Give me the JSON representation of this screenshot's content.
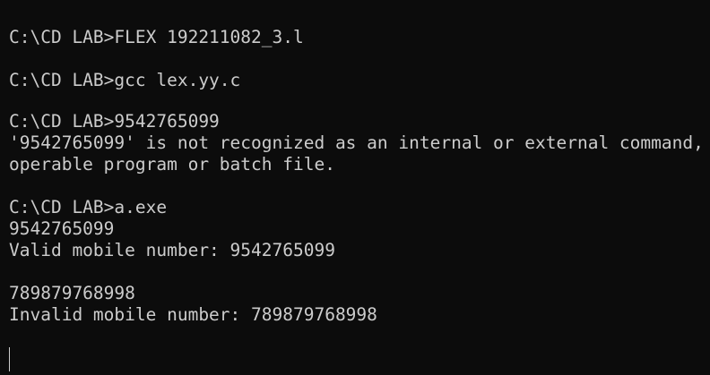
{
  "terminal": {
    "lines": [
      "C:\\CD LAB>FLEX 192211082_3.l",
      "C:\\CD LAB>gcc lex.yy.c",
      "C:\\CD LAB>9542765099",
      "'9542765099' is not recognized as an internal or external command,",
      "operable program or batch file.",
      "C:\\CD LAB>a.exe",
      "9542765099",
      "Valid mobile number: 9542765099",
      "789879768998",
      "Invalid mobile number: 789879768998"
    ]
  }
}
